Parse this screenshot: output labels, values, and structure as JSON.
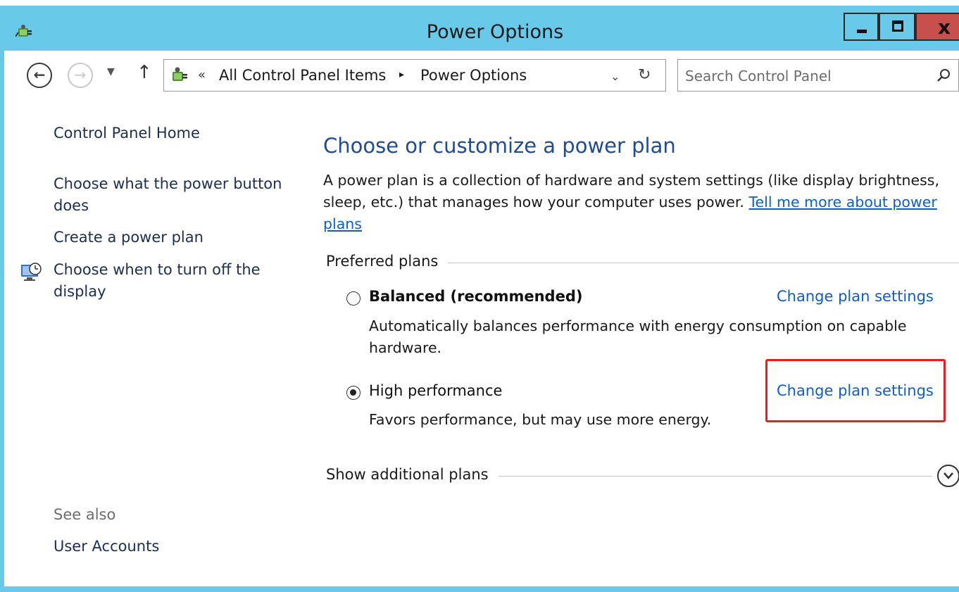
{
  "window": {
    "title": "Power Options",
    "minimize_label": "",
    "maximize_label": "",
    "close_label": "x",
    "frame_color": "#69c9e8"
  },
  "addressbar": {
    "back_icon": "back-arrow-icon",
    "forward_icon": "forward-arrow-icon",
    "recent_icon": "chevron-down-icon",
    "up_icon": "up-arrow-icon",
    "breadcrumb_prefix": "«",
    "breadcrumb": [
      "All Control Panel Items",
      "Power Options"
    ],
    "breadcrumb_separator": "▸",
    "dropdown_icon": "chevron-down-icon",
    "refresh_icon": "refresh-icon",
    "search_placeholder": "Search Control Panel"
  },
  "sidebar": {
    "home": "Control Panel Home",
    "links": [
      "Choose what the power button does",
      "Create a power plan",
      "Choose when to turn off the display"
    ],
    "see_also_label": "See also",
    "see_also_links": [
      "User Accounts"
    ]
  },
  "main": {
    "title": "Choose or customize a power plan",
    "description": "A power plan is a collection of hardware and system settings (like display brightness, sleep, etc.) that manages how your computer uses power.",
    "learn_more_link": "Tell me more about power plans",
    "preferred_label": "Preferred plans",
    "plans": [
      {
        "name": "Balanced (recommended)",
        "description": "Automatically balances performance with energy consumption on capable hardware.",
        "selected": false,
        "link": "Change plan settings"
      },
      {
        "name": "High performance",
        "description": "Favors performance, but may use more energy.",
        "selected": true,
        "link": "Change plan settings"
      }
    ],
    "show_additional": "Show additional plans",
    "link_color": "#0b5fd0",
    "title_color": "#1e4b9a",
    "highlight_color": "#ee1c1c"
  }
}
